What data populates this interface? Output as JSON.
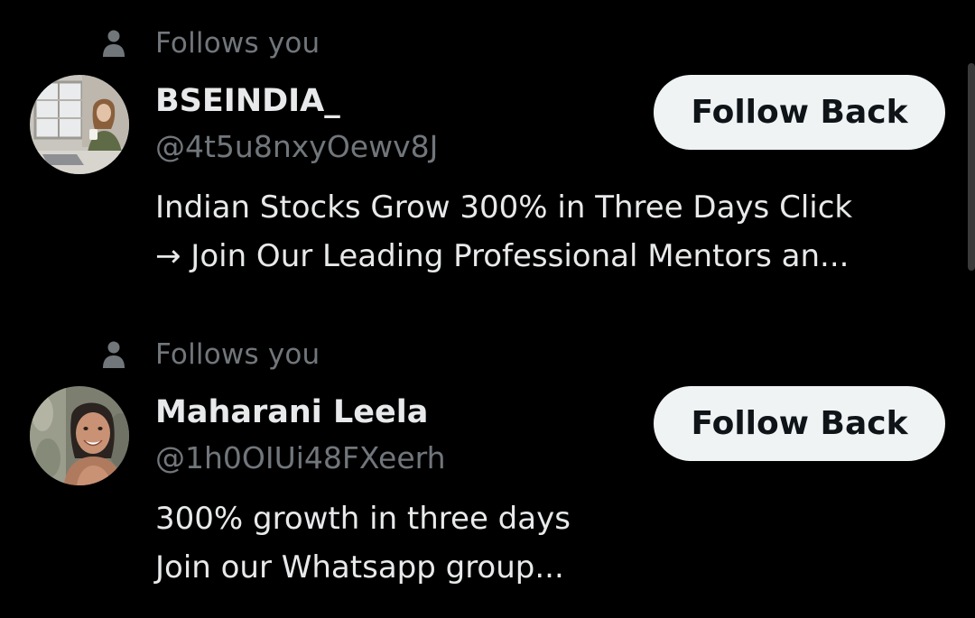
{
  "colors": {
    "background": "#000000",
    "primary_text": "#e7e9ea",
    "secondary_text": "#71767b",
    "button_bg": "#eff3f4",
    "button_text": "#0f1419"
  },
  "follower_cards": [
    {
      "follows_label": "Follows you",
      "follows_icon": "person-icon",
      "avatar": "woman-at-desk-photo",
      "display_name": "BSEINDIA_",
      "handle": "@4t5u8nxyOewv8J",
      "bio_lines": [
        "Indian Stocks Grow 300% in Three Days Click",
        "→ Join Our Leading Professional Mentors an..."
      ],
      "button_label": "Follow Back"
    },
    {
      "follows_label": "Follows you",
      "follows_icon": "person-icon",
      "avatar": "smiling-woman-photo",
      "display_name": "Maharani Leela",
      "handle": "@1h0OIUi48FXeerh",
      "bio_lines": [
        "300% growth in three days",
        "Join our Whatsapp group..."
      ],
      "button_label": "Follow Back"
    }
  ]
}
